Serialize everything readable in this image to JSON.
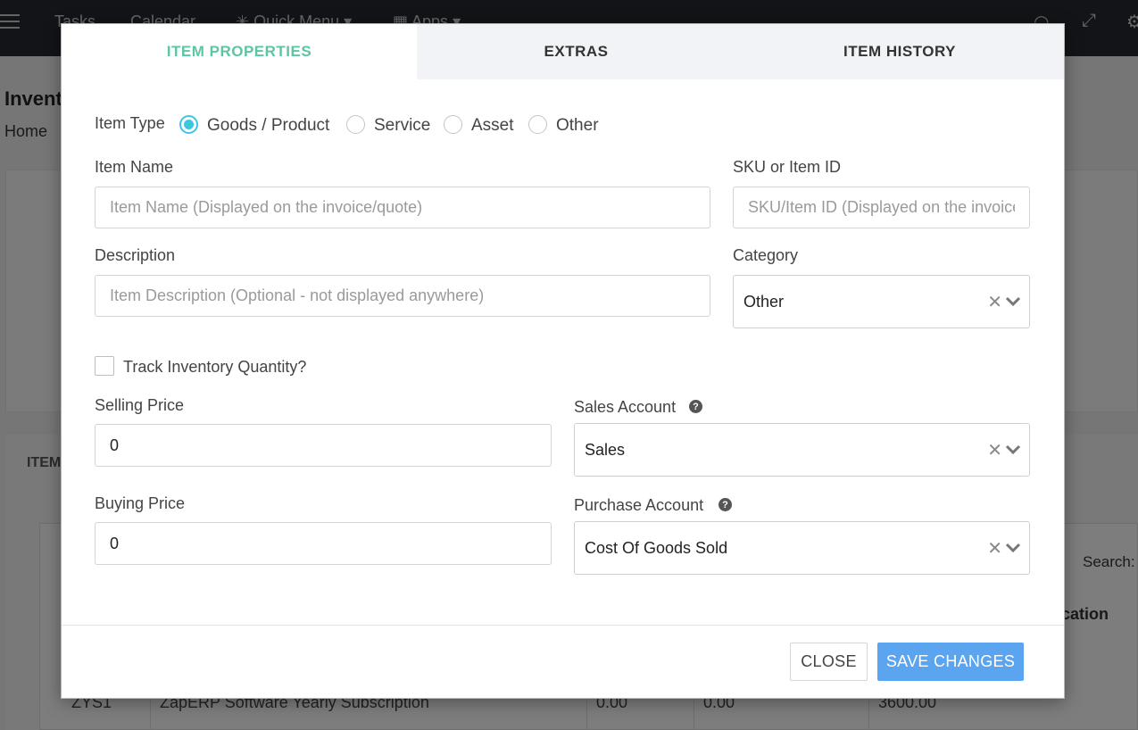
{
  "background": {
    "nav": [
      "Tasks",
      "Calendar",
      "Quick Menu",
      "Apps"
    ],
    "page_title": "Invent",
    "breadcrumb": "Home",
    "tab_label": "ITEM",
    "search_label": "Search:",
    "column_location": "ocation",
    "row": {
      "sku": "ZYS1",
      "name": "ZapERP Software Yearly Subscription",
      "col3": "0.00",
      "col4": "0.00",
      "col5": "3600.00"
    }
  },
  "modal": {
    "tabs": [
      {
        "label": "ITEM PROPERTIES",
        "active": true
      },
      {
        "label": "EXTRAS",
        "active": false
      },
      {
        "label": "ITEM HISTORY",
        "active": false
      }
    ],
    "item_type": {
      "label": "Item Type",
      "options": [
        "Goods / Product",
        "Service",
        "Asset",
        "Other"
      ],
      "selected": "Goods / Product"
    },
    "item_name": {
      "label": "Item Name",
      "placeholder": "Item Name (Displayed on the invoice/quote)",
      "value": ""
    },
    "sku": {
      "label": "SKU or Item ID",
      "placeholder": "SKU/Item ID (Displayed on the invoice/quote)",
      "value": ""
    },
    "description": {
      "label": "Description",
      "placeholder": "Item Description (Optional - not displayed anywhere)",
      "value": ""
    },
    "category": {
      "label": "Category",
      "value": "Other"
    },
    "track_inventory": {
      "label": "Track Inventory Quantity?",
      "checked": false
    },
    "selling_price": {
      "label": "Selling Price",
      "value": "0"
    },
    "buying_price": {
      "label": "Buying Price",
      "value": "0"
    },
    "sales_account": {
      "label": "Sales Account",
      "value": "Sales"
    },
    "purchase_account": {
      "label": "Purchase Account",
      "value": "Cost Of Goods Sold"
    },
    "buttons": {
      "close": "CLOSE",
      "save": "SAVE CHANGES"
    }
  },
  "colors": {
    "active_tab": "#5cc5a3",
    "radio": "#3ec6e0",
    "save_button": "#5aa4f0"
  }
}
